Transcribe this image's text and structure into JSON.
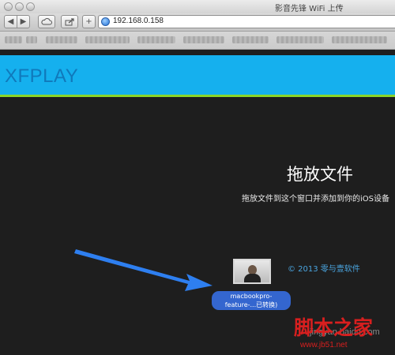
{
  "window": {
    "title": "影音先锋 WiFi 上传"
  },
  "toolbar": {
    "back_icon": "chevron-left-icon",
    "forward_icon": "chevron-right-icon",
    "cloud_icon": "cloud-icon",
    "share_icon": "share-icon",
    "add_label": "+",
    "url": "192.168.0.158"
  },
  "header": {
    "logo": "XFPLAY",
    "bg_color": "#15b0ee",
    "accent_color": "#8ad52a"
  },
  "dropzone": {
    "title": "拖放文件",
    "subtitle": "拖放文件到这个窗口并添加到你的iOS设备"
  },
  "footer": {
    "copyright": "© 2013 零与壹软件"
  },
  "drag_item": {
    "line1": "macbookpro-",
    "line2": "feature-...已转换)"
  },
  "watermark": {
    "text": "脚本之家",
    "url": "www.jb51.net",
    "baidu": "jingyan.baidu.com"
  }
}
